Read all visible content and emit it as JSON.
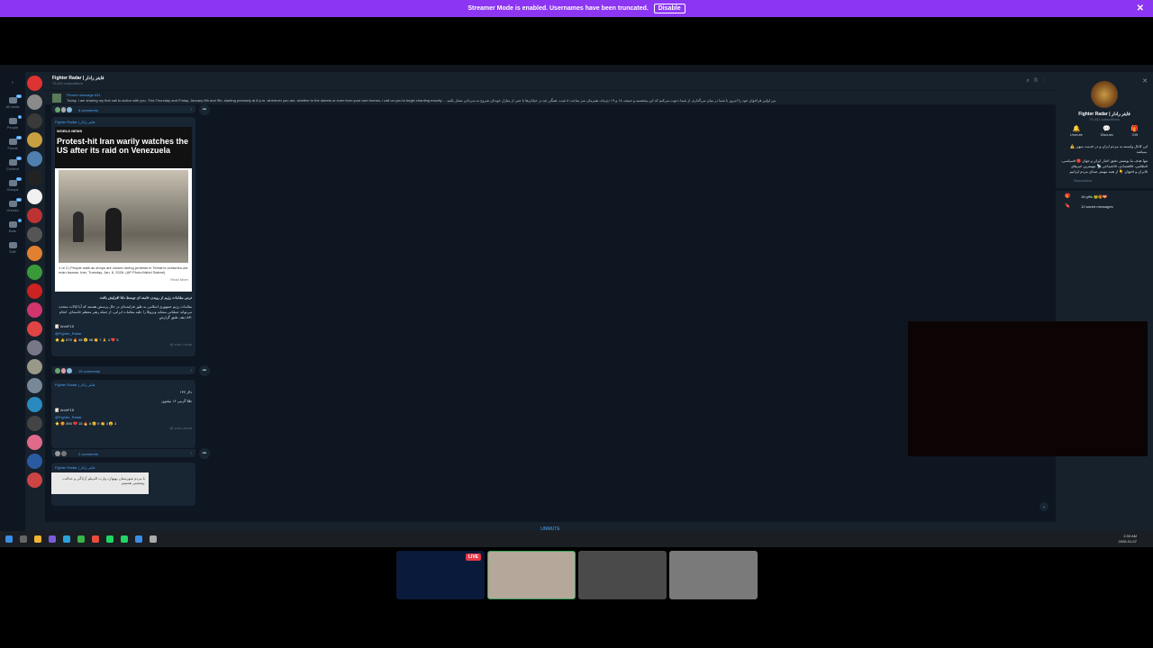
{
  "banner": {
    "text": "Streamer Mode is enabled. Usernames have been truncated.",
    "disable_label": "Disable",
    "close": "✕"
  },
  "folders": [
    {
      "label": "All chats",
      "badge": "99"
    },
    {
      "label": "People",
      "badge": "4"
    },
    {
      "label": "Feeds",
      "badge": "18"
    },
    {
      "label": "Content",
      "badge": "21"
    },
    {
      "label": "Groups",
      "badge": "17"
    },
    {
      "label": "Unread",
      "badge": "99"
    },
    {
      "label": "Bots",
      "badge": "1"
    },
    {
      "label": "Edit",
      "badge": ""
    }
  ],
  "chat": {
    "title": "Fighter Radar | فایتر رادار",
    "subtitle": "79,431 subscribers",
    "pinned_label": "Pinned message #31",
    "pinned_text": "Today, I am sharing my first call to action with you. This Thursday and Friday, January 8th and 9th, starting precisely at 8 p.m. wherever you are, whether in the streets or even from your own homes, I call on you to begin chanting exactly ...  من اولین فراخوان خود را امروز با شما در میان می‌گذارم. از شما دعوت می‌کنم که این پنجشنبه و جمعه، ۱۸ و ۱۹ دی‌ماه، همزمان سر ساعت ۸ شب، همگی چه در خیابان‌ها یا حتی از منازل خودتان شروع به سردادن شعار بکنید",
    "unmute": "UNMUTE"
  },
  "messages": {
    "m1_comments": "6 comments",
    "m2_channel": "Fighter Radar | فایتر رادار",
    "m2_worldnews": "WORLD NEWS",
    "m2_headline": "Protest-hit Iran warily watches the US after its raid on Venezuela",
    "m2_caption": "1 of 2 | People walk as shops are closed during protests in Tehran's centuries-old main bazaar, Iran, Tuesday, Jan. 6, 2026. (AP Photo/Vahid Salemi)",
    "m2_readmore": "Read More",
    "m2_title_fa": "ترس مقامات رژیم از رویدن خامنه ای توسط دلتا افزایش یافت",
    "m2_body_fa": "مقامات رژیم جمهوری اسلامی به طور فزاینده‌ای در حال پرسش هستند که آیا ایالات متحده می‌تواند عملیاتی مشابه ونزوئلا را علیه مقامات ایرانی، از جمله رهبر معظم خامنه‌ای، انجام دهد، طبق گزارش AP.",
    "m2_sig": "📝 AmirF15",
    "m2_link": "@Fighter_Radar",
    "m2_reacts": "⭐ 👍 579  🔥 48  😢 98  👏 7  🙏 4  ❤️ 3",
    "m2_meta": "👁 12.8K  1:16 AM",
    "m2_comments": "15 comments",
    "m3_channel": "Fighter Radar | فایتر رادار",
    "m3_line1": "دلار ۱۳۷",
    "m3_line2": "طلا گرمی ۱۶ میلیون",
    "m3_sig": "📝 AmirF15",
    "m3_link": "@Fighter_Radar",
    "m3_reacts": "⭐ 😡 390  💔 15  🔥 8  😢 9  👏 3  😮 3",
    "m3_meta": "👁 12.6K  1:20 AM",
    "m3_comments": "2 comments",
    "m4_channel": "Fighter Radar | فایتر رادار",
    "m4_preview": "با مردم شهرستان بهبهان، وارث الدیپلم آزادگی و عدالت، وشعبتی هستیم."
  },
  "sidebar": {
    "name": "Fighter Radar | فایتر رادار",
    "subs": "79,431 subscribers",
    "actions": [
      {
        "label": "Unmute",
        "icon": "🔔"
      },
      {
        "label": "Discuss",
        "icon": "💬"
      },
      {
        "label": "Gift",
        "icon": "🎁"
      }
    ],
    "desc1": "⚠️ این کانال وابسته به مردم ایران و در خدمت میهن میباشد.",
    "desc2": "تنها هدف ما پوشش دقیق اخبار ایران و جهان 🔴 #سیاسی، #نظامی، #اقتصادی، #اجتماعی 📡 مهمترین خبرهای #ایران و #جهان 👇 از همه مهمتر صدای مردم ایرانیم",
    "desc_label": "Description",
    "gifts": "16 gifts 🐸🎁💝",
    "saved": "12 saved messages"
  },
  "taskbar": {
    "time": "2:33 AM",
    "date": "2026-01-07"
  },
  "colors": {
    "banner": "#8c35f2",
    "accent": "#4ea4f5",
    "bg": "#0e1621",
    "panel": "#17212b"
  }
}
